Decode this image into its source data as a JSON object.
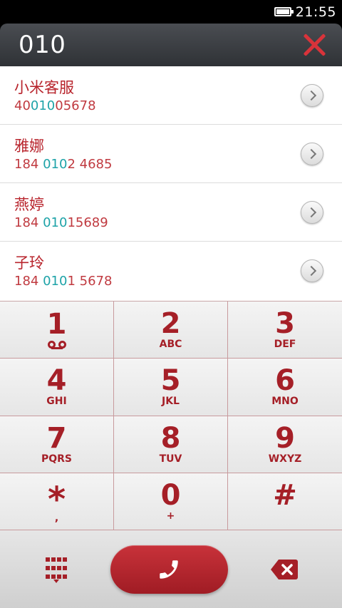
{
  "status": {
    "time": "21:55",
    "battery_level": 1.0
  },
  "dialer": {
    "number": "010"
  },
  "contacts": [
    {
      "name": "小米客服",
      "number_parts": [
        "40",
        "010",
        "05678"
      ]
    },
    {
      "name": "雅娜",
      "number_parts": [
        "184 ",
        "010",
        "2 4685"
      ]
    },
    {
      "name": "燕婷",
      "number_parts": [
        "184 ",
        "010",
        "15689"
      ]
    },
    {
      "name": "子玲",
      "number_parts": [
        "184 ",
        "010",
        "1 5678"
      ]
    }
  ],
  "keypad": [
    {
      "digit": "1",
      "sub": ""
    },
    {
      "digit": "2",
      "sub": "ABC"
    },
    {
      "digit": "3",
      "sub": "DEF"
    },
    {
      "digit": "4",
      "sub": "GHI"
    },
    {
      "digit": "5",
      "sub": "JKL"
    },
    {
      "digit": "6",
      "sub": "MNO"
    },
    {
      "digit": "7",
      "sub": "PQRS"
    },
    {
      "digit": "8",
      "sub": "TUV"
    },
    {
      "digit": "9",
      "sub": "WXYZ"
    },
    {
      "digit": "*",
      "sub": ","
    },
    {
      "digit": "0",
      "sub": "+"
    },
    {
      "digit": "#",
      "sub": ""
    }
  ],
  "icons": {
    "clear": "close-icon",
    "contact_detail": "chevron-right-icon",
    "voicemail": "voicemail-icon",
    "keypad_toggle": "dialpad-icon",
    "call": "phone-icon",
    "backspace": "backspace-icon"
  },
  "colors": {
    "accent": "#a51f27",
    "highlight": "#1ea3a8",
    "clear": "#d9333a"
  }
}
